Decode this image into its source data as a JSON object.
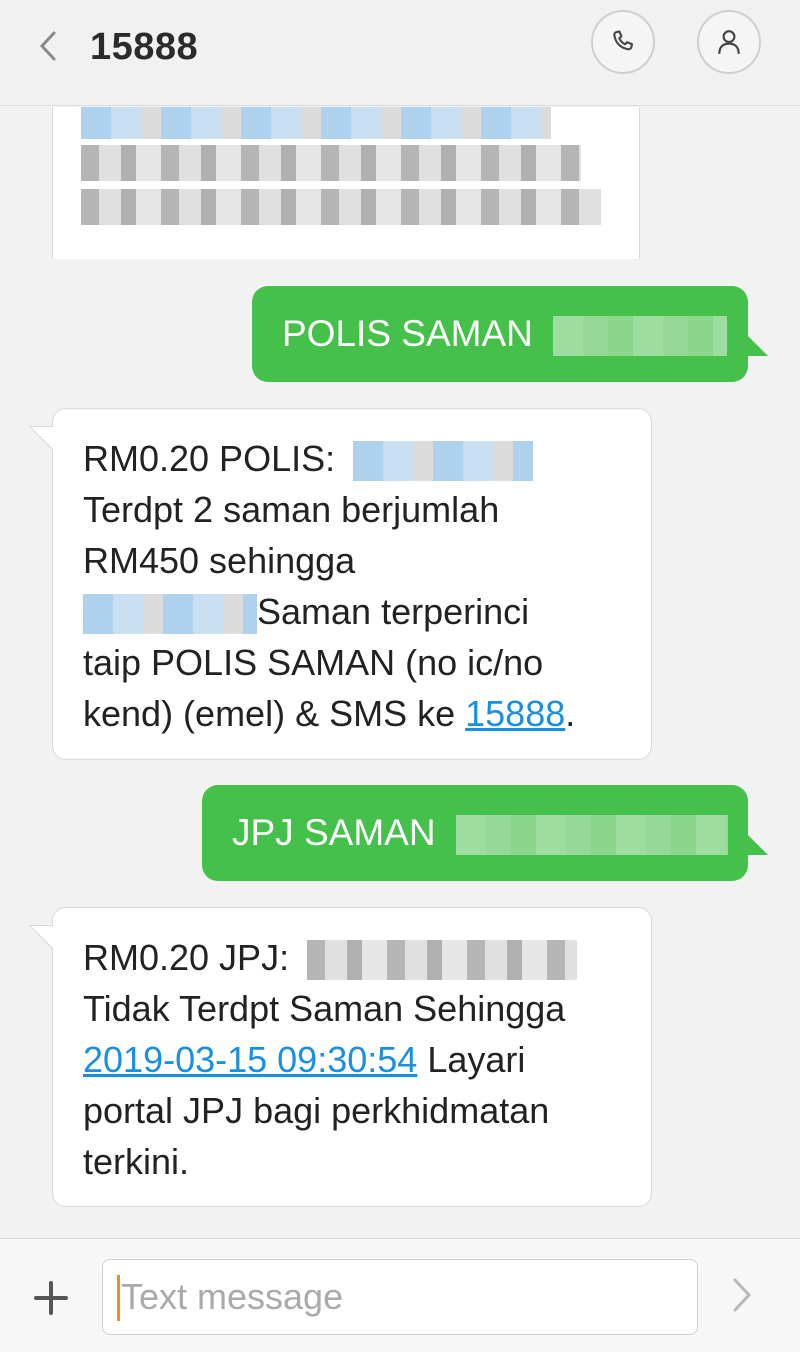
{
  "header": {
    "title": "15888",
    "back_icon": "chevron-left-icon",
    "call_icon": "phone-icon",
    "contact_icon": "person-icon"
  },
  "messages": [
    {
      "direction": "outgoing",
      "text": "POLIS SAMAN"
    },
    {
      "direction": "incoming",
      "line1": "RM0.20 POLIS:",
      "line2": "Terdpt 2 saman berjumlah",
      "line3": "RM450 sehingga",
      "line4": "Saman terperinci",
      "line5": "taip POLIS SAMAN (no ic/no",
      "line6_prefix": "kend) (emel) & SMS ke",
      "line6_link": "15888",
      "line6_suffix": "."
    },
    {
      "direction": "outgoing",
      "text": "JPJ SAMAN"
    },
    {
      "direction": "incoming",
      "line1": "RM0.20 JPJ:",
      "line2": "Tidak Terdpt Saman Sehingga",
      "line3_link": "2019-03-15 09:30:54",
      "line3_suffix": "Layari",
      "line4": "portal JPJ bagi perkhidmatan",
      "line5": "terkini."
    }
  ],
  "composer": {
    "placeholder": "Text message",
    "plus_icon": "plus-icon",
    "send_icon": "send-chevron-icon"
  },
  "colors": {
    "outgoing_bubble": "#45c04a",
    "link": "#1a8fe0",
    "caret": "#f08a24"
  }
}
